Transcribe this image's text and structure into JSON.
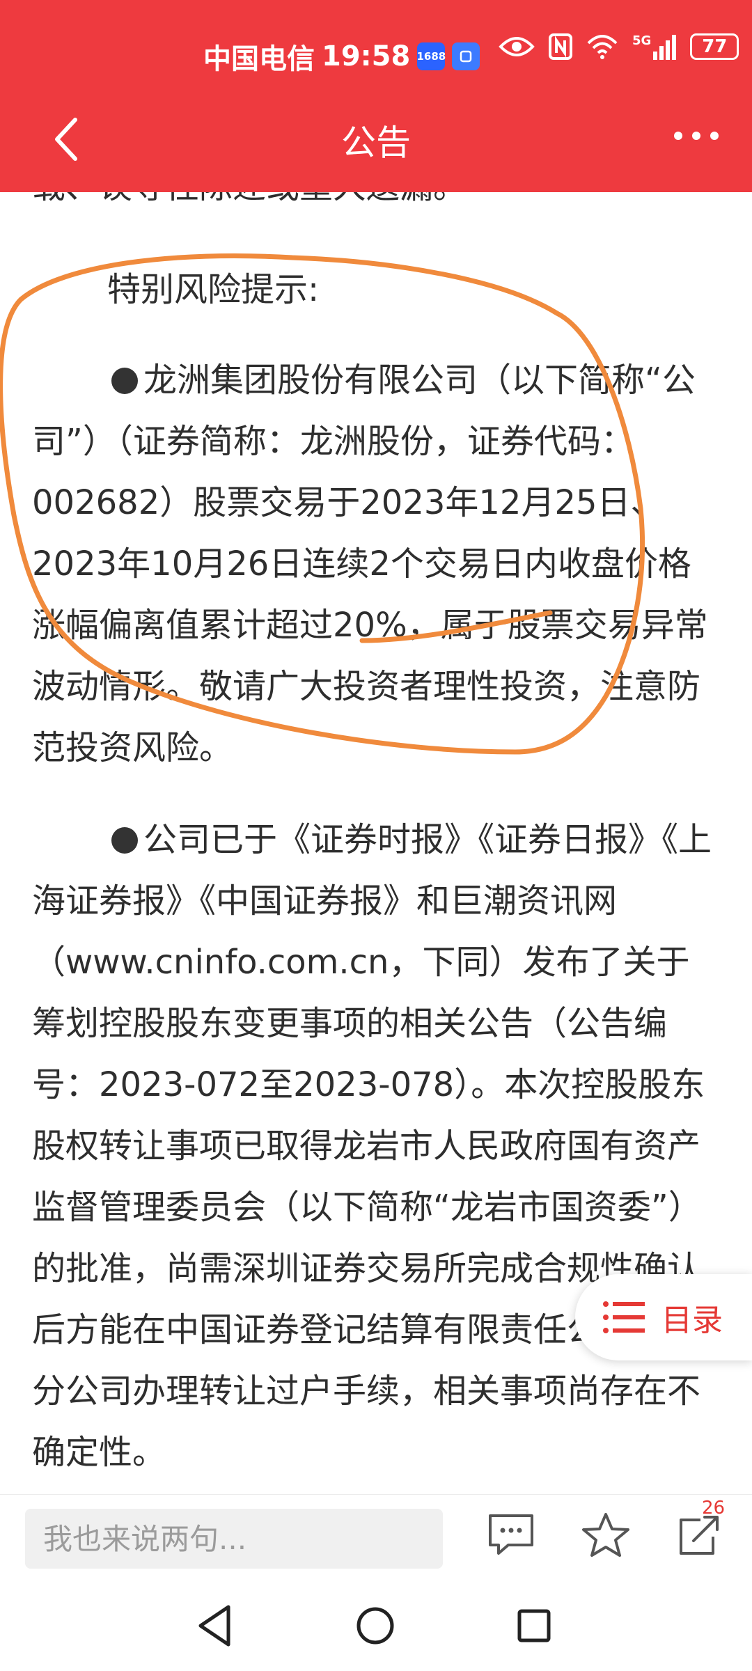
{
  "status_bar": {
    "carrier": "中国电信",
    "time": "19:58",
    "app_badge": "1688",
    "network": "5G",
    "battery": "77"
  },
  "header": {
    "title": "公告"
  },
  "content": {
    "cut_line": "载、误导性陈述或重大遗漏。",
    "risk_title": "特别风险提示:",
    "paragraph_1": "龙洲集团股份有限公司（以下简称“公司”）（证券简称：龙洲股份，证券代码：002682）股票交易于2023年12月25日、2023年10月26日连续2个交易日内收盘价格涨幅偏离值累计超过20%，属于股票交易异常波动情形。敬请广大投资者理性投资，注意防范投资风险。",
    "paragraph_2": "公司已于《证券时报》《证券日报》《上海证券报》《中国证券报》和巨潮资讯网（www.cninfo.com.cn，下同）发布了关于筹划控股股东变更事项的相关公告（公告编号：2023-072至2023-078）。本次控股股东股权转让事项已取得龙岩市人民政府国有资产监督管理委员会（以下简称“龙岩市国资委”）的批准，尚需深圳证券交易所完成合规性确认后方能在中国证券登记结算有限责任公司深圳分公司办理转让过户手续，相关事项尚存在不确定性。"
  },
  "toc": {
    "label": "目录"
  },
  "bottom_bar": {
    "comment_placeholder": "我也来说两句...",
    "share_count": "26"
  },
  "colors": {
    "brand_red": "#ee3a3f",
    "annotation_orange": "#f08a3c",
    "accent_red": "#e53935"
  }
}
